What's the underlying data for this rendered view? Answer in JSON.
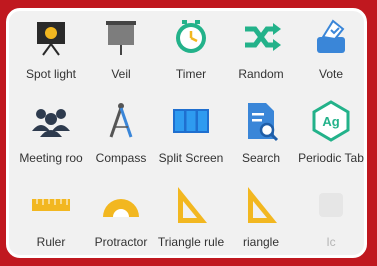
{
  "tools": [
    {
      "label": "Spot light",
      "icon": "spotlight-icon"
    },
    {
      "label": "Veil",
      "icon": "veil-icon"
    },
    {
      "label": "Timer",
      "icon": "timer-icon"
    },
    {
      "label": "Random",
      "icon": "random-icon"
    },
    {
      "label": "Vote",
      "icon": "vote-icon"
    },
    {
      "label": "Meeting roo",
      "icon": "meeting-room-icon"
    },
    {
      "label": "Compass",
      "icon": "compass-icon"
    },
    {
      "label": "Split Screen",
      "icon": "split-screen-icon"
    },
    {
      "label": "Search",
      "icon": "search-icon"
    },
    {
      "label": "Periodic Tab",
      "icon": "periodic-table-icon"
    },
    {
      "label": "Ruler",
      "icon": "ruler-icon"
    },
    {
      "label": "Protractor",
      "icon": "protractor-icon"
    },
    {
      "label": "Triangle rule",
      "icon": "triangle-ruler-icon"
    },
    {
      "label": "riangle",
      "icon": "triangle-ruler-icon"
    },
    {
      "label": "Ic",
      "icon": "faded-icon"
    }
  ],
  "colors": {
    "background": "#c0181f",
    "panel": "#f1f1f1",
    "accent_blue": "#3a86d8",
    "accent_green": "#23b28a",
    "accent_yellow": "#f2b720"
  }
}
